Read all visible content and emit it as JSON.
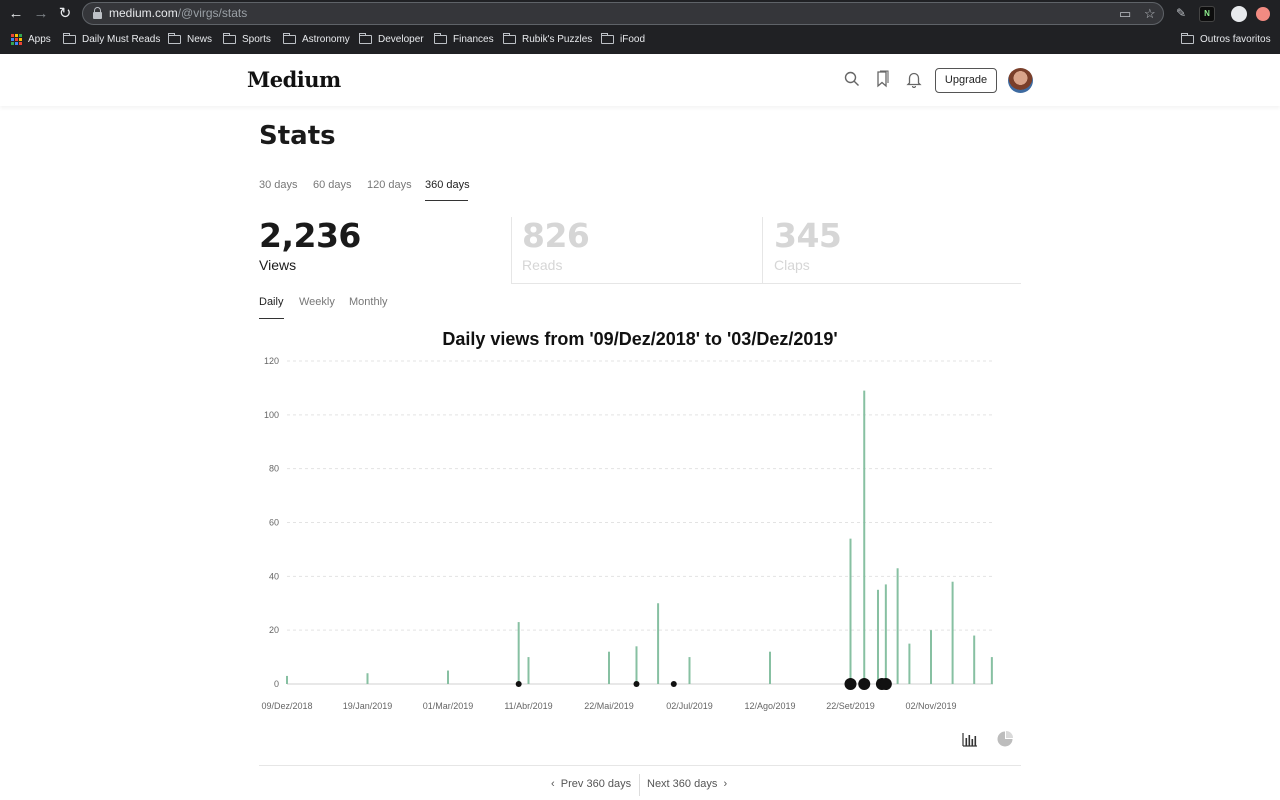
{
  "browser": {
    "url_host": "medium.com",
    "url_path": "/@virgs/stats",
    "bookmarks": [
      "Apps",
      "Daily Must Reads",
      "News",
      "Sports",
      "Astronomy",
      "Developer",
      "Finances",
      "Rubik's Puzzles",
      "iFood"
    ],
    "other_bookmarks": "Outros favoritos"
  },
  "header": {
    "logo": "Medium",
    "upgrade_label": "Upgrade",
    "icons": [
      "search-icon",
      "bookmark-icon",
      "bell-icon"
    ]
  },
  "page": {
    "title": "Stats",
    "period_tabs": [
      "30 days",
      "60 days",
      "120 days",
      "360 days"
    ],
    "active_period": "360 days",
    "metrics": [
      {
        "value": "2,236",
        "label": "Views",
        "active": true
      },
      {
        "value": "826",
        "label": "Reads",
        "active": false
      },
      {
        "value": "345",
        "label": "Claps",
        "active": false
      }
    ],
    "granularity_tabs": [
      "Daily",
      "Weekly",
      "Monthly"
    ],
    "active_granularity": "Daily",
    "pager": {
      "prev": "Prev 360 days",
      "next": "Next 360 days"
    }
  },
  "colors": {
    "bar": "#87c0a2",
    "bar_dark": "#3f6e58",
    "marker": "#111111"
  },
  "chart_data": {
    "type": "bar",
    "title": "Daily views from '09/Dez/2018' to '03/Dez/2019'",
    "xlabel": "",
    "ylabel": "",
    "ylim": [
      0,
      120
    ],
    "yticks": [
      0,
      20,
      40,
      60,
      80,
      100,
      120
    ],
    "xticks": [
      "09/Dez/2018",
      "19/Jan/2019",
      "01/Mar/2019",
      "11/Abr/2019",
      "22/Mai/2019",
      "02/Jul/2019",
      "12/Ago/2019",
      "22/Set/2019",
      "02/Nov/2019"
    ],
    "grid": true,
    "series": [
      {
        "x": [
          "09/Dez/2018",
          "19/Jan/2019",
          "01/Mar/2019",
          "06/Abr/2019",
          "11/Abr/2019",
          "22/Mai/2019",
          "05/Jun/2019",
          "16/Jun/2019",
          "02/Jul/2019",
          "12/Ago/2019",
          "22/Set/2019",
          "29/Set/2019",
          "06/Out/2019",
          "10/Out/2019",
          "16/Out/2019",
          "22/Out/2019",
          "02/Nov/2019",
          "13/Nov/2019",
          "24/Nov/2019",
          "03/Dez/2019"
        ],
        "values": [
          3,
          4,
          5,
          23,
          10,
          12,
          14,
          30,
          10,
          12,
          54,
          109,
          35,
          37,
          43,
          15,
          20,
          38,
          18,
          10
        ]
      }
    ],
    "markers": [
      {
        "x": "06/Abr/2019",
        "size": "small"
      },
      {
        "x": "05/Jun/2019",
        "size": "small"
      },
      {
        "x": "24/Jun/2019",
        "size": "small"
      },
      {
        "x": "22/Set/2019",
        "size": "large"
      },
      {
        "x": "29/Set/2019",
        "size": "large"
      },
      {
        "x": "08/Out/2019",
        "size": "large"
      },
      {
        "x": "10/Out/2019",
        "size": "large"
      }
    ],
    "view_options": [
      "bar-chart-icon",
      "pie-chart-icon"
    ]
  }
}
